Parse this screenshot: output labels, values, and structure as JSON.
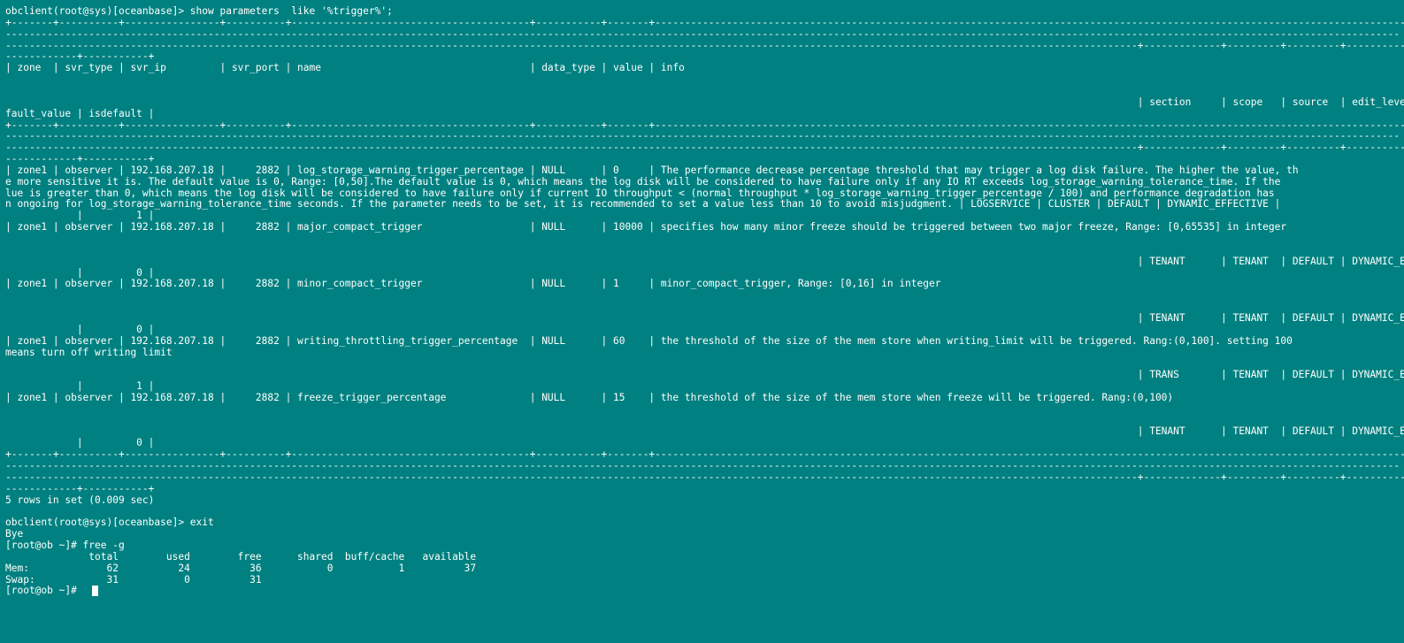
{
  "terminal": {
    "lines": [
      "obclient(root@sys)[oceanbase]> show parameters  like '%trigger%';",
      "+-------+----------+----------------+----------+----------------------------------------+-----------+-------+----------------------------------------------------------------------------------------------------------------------------------------------------",
      "------------------------------------------------------------------------------------------------------------------------------------------------------------------------------------------------------------------------------------------",
      "----------------------------------------------------------------------------------------------------------------------------------------------------------------------------------------------+-------------+---------+---------+----------",
      "------------+-----------+",
      "| zone  | svr_type | svr_ip         | svr_port | name                                   | data_type | value | info",
      "",
      "",
      "                                                                                                                                                                                              | section     | scope   | source  | edit_level | de",
      "fault_value | isdefault |",
      "+-------+----------+----------------+----------+----------------------------------------+-----------+-------+----------------------------------------------------------------------------------------------------------------------------------------------------",
      "------------------------------------------------------------------------------------------------------------------------------------------------------------------------------------------------------------------------------------------",
      "----------------------------------------------------------------------------------------------------------------------------------------------------------------------------------------------+-------------+---------+---------+----------",
      "------------+-----------+",
      "| zone1 | observer | 192.168.207.18 |     2882 | log_storage_warning_trigger_percentage | NULL      | 0     | The performance decrease percentage threshold that may trigger a log disk failure. The higher the value, th",
      "e more sensitive it is. The default value is 0, Range: [0,50].The default value is 0, which means the log disk will be considered to have failure only if any IO RT exceeds log_storage_warning_tolerance_time. If the",
      "lue is greater than 0, which means the log disk will be considered to have failure only if current IO throughput < (normal throughput * log_storage_warning_trigger_percentage / 100) and performance degradation has",
      "n ongoing for log_storage_warning_tolerance_time seconds. If the parameter needs to be set, it is recommended to set a value less than 10 to avoid misjudgment. | LOGSERVICE | CLUSTER | DEFAULT | DYNAMIC_EFFECTIVE |",
      "            |         1 |",
      "| zone1 | observer | 192.168.207.18 |     2882 | major_compact_trigger                  | NULL      | 10000 | specifies how many minor freeze should be triggered between two major freeze, Range: [0,65535] in integer",
      "",
      "",
      "                                                                                                                                                                                              | TENANT      | TENANT  | DEFAULT | DYNAMIC_EF",
      "            |         0 |",
      "| zone1 | observer | 192.168.207.18 |     2882 | minor_compact_trigger                  | NULL      | 1     | minor_compact_trigger, Range: [0,16] in integer",
      "",
      "",
      "                                                                                                                                                                                              | TENANT      | TENANT  | DEFAULT | DYNAMIC_EF",
      "            |         0 |",
      "| zone1 | observer | 192.168.207.18 |     2882 | writing_throttling_trigger_percentage  | NULL      | 60    | the threshold of the size of the mem store when writing_limit will be triggered. Rang:(0,100]. setting 100",
      "means turn off writing limit",
      "",
      "                                                                                                                                                                                              | TRANS       | TENANT  | DEFAULT | DYNAMIC_EF",
      "            |         1 |",
      "| zone1 | observer | 192.168.207.18 |     2882 | freeze_trigger_percentage              | NULL      | 15    | the threshold of the size of the mem store when freeze will be triggered. Rang:(0,100)",
      "",
      "",
      "                                                                                                                                                                                              | TENANT      | TENANT  | DEFAULT | DYNAMIC_EF",
      "            |         0 |",
      "+-------+----------+----------------+----------+----------------------------------------+-----------+-------+----------------------------------------------------------------------------------------------------------------------------------------------------",
      "------------------------------------------------------------------------------------------------------------------------------------------------------------------------------------------------------------------------------------------",
      "----------------------------------------------------------------------------------------------------------------------------------------------------------------------------------------------+-------------+---------+---------+----------",
      "------------+-----------+",
      "5 rows in set (0.009 sec)",
      "",
      "obclient(root@sys)[oceanbase]> exit",
      "Bye",
      "[root@ob ~]# free -g",
      "              total        used        free      shared  buff/cache   available",
      "Mem:             62          24          36           0           1          37",
      "Swap:            31           0          31",
      "[root@ob ~]# "
    ]
  }
}
